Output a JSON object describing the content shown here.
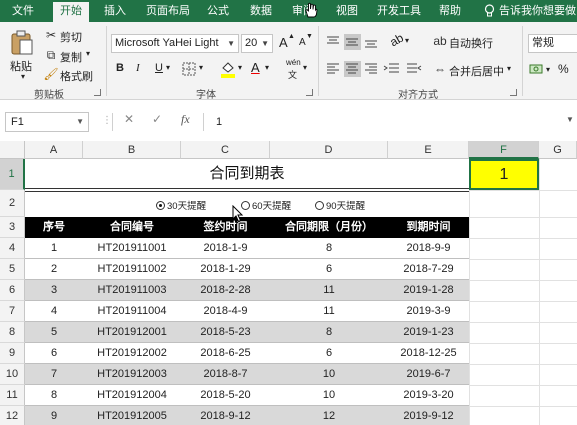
{
  "ribbon_tabs": [
    "文件",
    "开始",
    "插入",
    "页面布局",
    "公式",
    "数据",
    "审阅",
    "视图",
    "开发工具",
    "帮助"
  ],
  "active_tab": "开始",
  "tell_me": "告诉我你想要做",
  "clipboard": {
    "paste": "粘贴",
    "cut": "剪切",
    "copy": "复制",
    "format_painter": "格式刷",
    "label": "剪贴板"
  },
  "font": {
    "name": "Microsoft YaHei Light",
    "size": "20",
    "label": "字体",
    "bold": "B",
    "italic": "I",
    "underline": "U",
    "grow": "A",
    "shrink": "A",
    "font_color": "A",
    "phonetic": "wén"
  },
  "alignment": {
    "wrap": "自动换行",
    "merge": "合并后居中",
    "label": "对齐方式"
  },
  "number": {
    "format": "常规",
    "percent": "%"
  },
  "formula_bar": {
    "name_box": "F1",
    "value": "1",
    "fx": "fx",
    "cancel": "✕",
    "enter": "✓"
  },
  "columns": [
    "A",
    "B",
    "C",
    "D",
    "E",
    "F",
    "G"
  ],
  "rows": [
    "1",
    "2",
    "3",
    "4",
    "5",
    "6",
    "7",
    "8",
    "9",
    "10",
    "11",
    "12"
  ],
  "sheet": {
    "title": "合同到期表",
    "f1_value": "1",
    "options": [
      {
        "label": "30天提醒",
        "selected": true
      },
      {
        "label": "60天提醒",
        "selected": false
      },
      {
        "label": "90天提醒",
        "selected": false
      }
    ],
    "headers": [
      "序号",
      "合同编号",
      "签约时间",
      "合同期限（月份）",
      "到期时间"
    ],
    "rows": [
      [
        "1",
        "HT201911001",
        "2018-1-9",
        "8",
        "2018-9-9"
      ],
      [
        "2",
        "HT201911002",
        "2018-1-29",
        "6",
        "2018-7-29"
      ],
      [
        "3",
        "HT201911003",
        "2018-2-28",
        "11",
        "2019-1-28"
      ],
      [
        "4",
        "HT201911004",
        "2018-4-9",
        "11",
        "2019-3-9"
      ],
      [
        "5",
        "HT201912001",
        "2018-5-23",
        "8",
        "2019-1-23"
      ],
      [
        "6",
        "HT201912002",
        "2018-6-25",
        "6",
        "2018-12-25"
      ],
      [
        "7",
        "HT201912003",
        "2018-8-7",
        "10",
        "2019-6-7"
      ],
      [
        "8",
        "HT201912004",
        "2018-5-20",
        "10",
        "2019-3-20"
      ],
      [
        "9",
        "HT201912005",
        "2018-9-12",
        "12",
        "2019-9-12"
      ]
    ],
    "shaded_rows": [
      2,
      4,
      6,
      8
    ]
  },
  "colors": {
    "excel_green": "#217346",
    "header_black": "#000000",
    "highlight_yellow": "#ffff00",
    "row_grey": "#d9d9d9"
  }
}
